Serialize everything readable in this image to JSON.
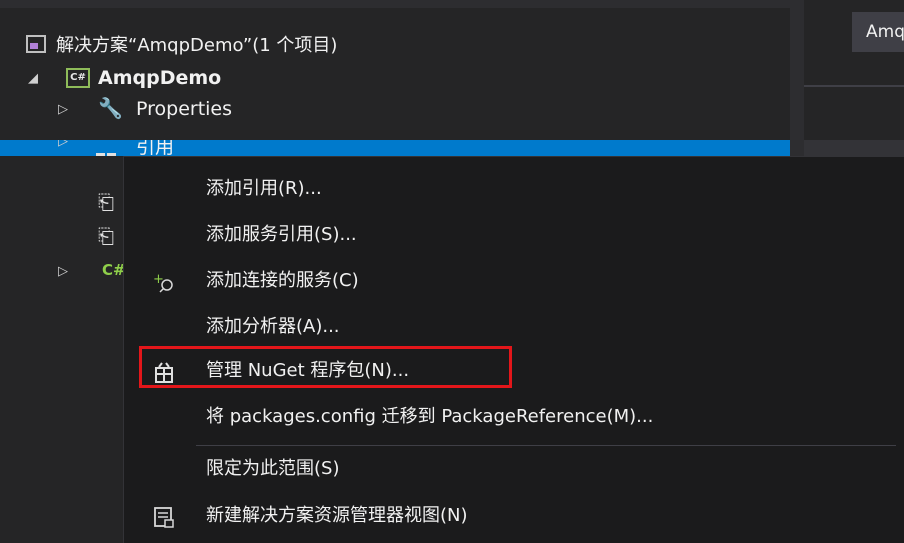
{
  "explorer": {
    "solution_label": "解决方案“AmqpDemo”(1 个项目)",
    "project_label": "AmqpDemo",
    "project_icon_text": "C#",
    "properties_label": "Properties",
    "references_label": "引用",
    "cs_icon_text": "C#"
  },
  "right_pane": {
    "tab_label": "Amq"
  },
  "context_menu": {
    "items": [
      {
        "label": "添加引用(R)...",
        "icon": ""
      },
      {
        "label": "添加服务引用(S)...",
        "icon": ""
      },
      {
        "label": "添加连接的服务(C)",
        "icon": "connected-service-icon"
      },
      {
        "label": "添加分析器(A)...",
        "icon": ""
      },
      {
        "label": "管理 NuGet 程序包(N)...",
        "icon": "nuget-package-icon"
      },
      {
        "label": "将 packages.config 迁移到 PackageReference(M)...",
        "icon": ""
      },
      {
        "label": "限定为此范围(S)",
        "icon": ""
      },
      {
        "label": "新建解决方案资源管理器视图(N)",
        "icon": "new-explorer-view-icon"
      }
    ],
    "highlight_color": "#e3161a"
  },
  "colors": {
    "selection": "#007acc",
    "background": "#252526",
    "menu_background": "#1b1b1c"
  }
}
